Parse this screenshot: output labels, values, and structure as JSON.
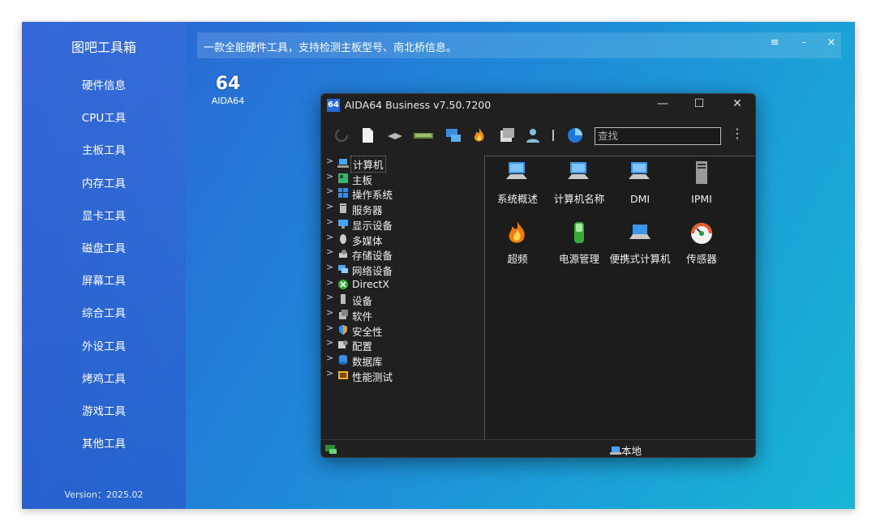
{
  "app": {
    "title": "图吧工具箱",
    "version": "Version：2025.02",
    "description": "一款全能硬件工具，支持检测主板型号、南北桥信息。"
  },
  "window_controls": {
    "menu": "≡",
    "minimize": "-",
    "close": "×"
  },
  "sidebar": {
    "items": [
      {
        "label": "硬件信息"
      },
      {
        "label": "CPU工具"
      },
      {
        "label": "主板工具"
      },
      {
        "label": "内存工具"
      },
      {
        "label": "显卡工具"
      },
      {
        "label": "磁盘工具"
      },
      {
        "label": "屏幕工具"
      },
      {
        "label": "综合工具"
      },
      {
        "label": "外设工具"
      },
      {
        "label": "烤鸡工具"
      },
      {
        "label": "游戏工具"
      },
      {
        "label": "其他工具"
      }
    ]
  },
  "desktop_icon": {
    "glyph": "64",
    "label": "AIDA64"
  },
  "aida": {
    "logo": "64",
    "title": "AIDA64 Business v7.50.7200",
    "controls": {
      "minimize": "—",
      "maximize": "☐",
      "close": "✕"
    },
    "search_placeholder": "查找",
    "toolbar_icons": [
      "refresh-icon",
      "report-icon",
      "motherboard-icon",
      "memory-icon",
      "network-icon",
      "flame-icon",
      "software-icon",
      "user-icon",
      "separator",
      "disk-icon"
    ],
    "tree": [
      {
        "label": "计算机",
        "icon": "computer-icon",
        "color": "#4aa3ff",
        "selected": true
      },
      {
        "label": "主板",
        "icon": "motherboard-icon",
        "color": "#3cb371"
      },
      {
        "label": "操作系统",
        "icon": "windows-icon",
        "color": "#2f8ff0"
      },
      {
        "label": "服务器",
        "icon": "server-icon",
        "color": "#bbbbbb"
      },
      {
        "label": "显示设备",
        "icon": "display-icon",
        "color": "#4aa3ff"
      },
      {
        "label": "多媒体",
        "icon": "multimedia-icon",
        "color": "#cccccc"
      },
      {
        "label": "存储设备",
        "icon": "storage-icon",
        "color": "#cccccc"
      },
      {
        "label": "网络设备",
        "icon": "network-icon",
        "color": "#4aa3ff"
      },
      {
        "label": "DirectX",
        "icon": "xbox-icon",
        "color": "#35b335"
      },
      {
        "label": "设备",
        "icon": "device-icon",
        "color": "#bbbbbb"
      },
      {
        "label": "软件",
        "icon": "software-icon",
        "color": "#bbbbbb"
      },
      {
        "label": "安全性",
        "icon": "shield-icon",
        "color": "#f0a030"
      },
      {
        "label": "配置",
        "icon": "config-icon",
        "color": "#cccccc"
      },
      {
        "label": "数据库",
        "icon": "database-icon",
        "color": "#3a8ee6"
      },
      {
        "label": "性能测试",
        "icon": "benchmark-icon",
        "color": "#f0b030"
      }
    ],
    "panel_items": [
      {
        "label": "系统概述",
        "icon": "computer-icon"
      },
      {
        "label": "计算机名称",
        "icon": "computer-icon"
      },
      {
        "label": "DMI",
        "icon": "computer-icon"
      },
      {
        "label": "IPMI",
        "icon": "server-icon"
      },
      {
        "label": "超频",
        "icon": "flame-icon"
      },
      {
        "label": "电源管理",
        "icon": "battery-icon"
      },
      {
        "label": "便携式计算机",
        "icon": "laptop-icon"
      },
      {
        "label": "传感器",
        "icon": "gauge-icon"
      }
    ],
    "status": {
      "location": "本地"
    }
  }
}
